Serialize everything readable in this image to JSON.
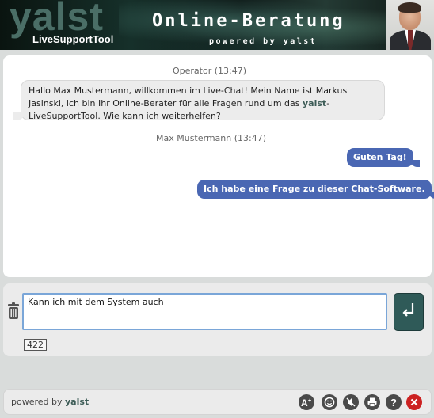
{
  "header": {
    "logo": "yalst",
    "logo_tagline": "LiveSupportTool",
    "title": "Online-Beratung",
    "powered_by": "powered by yalst"
  },
  "chat": {
    "messages": [
      {
        "sender": "Operator",
        "time": "(13:47)",
        "meta": "Operator  (13:47)",
        "text_before": "Hallo Max Mustermann, willkommen im Live-Chat! Mein Name ist Markus Jasinski, ich bin Ihr Online-Berater für alle Fragen rund um das ",
        "brand": "yalst",
        "text_after": "-LiveSupportTool. Wie kann ich weiterhelfen?"
      },
      {
        "sender": "Max Mustermann",
        "time": "(13:47)",
        "meta": "Max Mustermann (13:47)",
        "texts": [
          "Guten Tag!",
          "Ich habe eine Frage zu dieser Chat-Software."
        ]
      }
    ]
  },
  "input": {
    "value": "Kann ich mit dem System auch",
    "char_count": "422"
  },
  "footer": {
    "powered_prefix": "powered by ",
    "powered_brand": "yalst",
    "tools": [
      "font-size-icon",
      "emoticon-icon",
      "sound-off-icon",
      "print-icon",
      "help-icon",
      "close-icon"
    ]
  },
  "colors": {
    "brand": "#3d5c57",
    "user_bubble": "#4a67b3",
    "send_button": "#2f5a58",
    "close": "#cc2222"
  }
}
